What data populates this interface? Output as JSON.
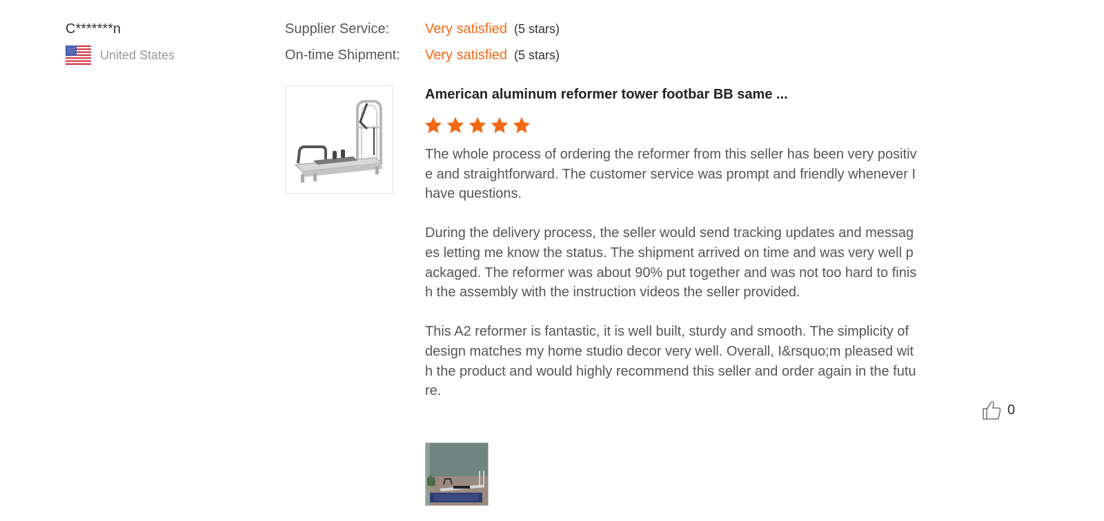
{
  "reviewer": {
    "name": "C*******n",
    "country": "United States",
    "flag_icon": "us-flag-icon"
  },
  "ratings": [
    {
      "label": "Supplier Service:",
      "value": "Very satisfied",
      "stars_text": "(5 stars)"
    },
    {
      "label": "On-time Shipment:",
      "value": "Very satisfied",
      "stars_text": "(5 stars)"
    }
  ],
  "product": {
    "title": "American aluminum reformer tower footbar BB same ...",
    "thumbnail_icon": "reformer-product-image"
  },
  "review": {
    "stars": 5,
    "star_color": "#f06a16",
    "paragraphs": [
      "The whole process of ordering the reformer from this seller has been very positive and straightforward. The customer service was prompt and friendly whenever I have questions.",
      "During the delivery process,  the seller would send tracking updates and messages letting me know the status. The shipment arrived on time and was very well packaged. The reformer was about 90% put together and was not too hard to finish the assembly with the instruction videos the seller provided.",
      "This A2 reformer is fantastic, it is well built, sturdy and smooth. The simplicity of design matches my home studio decor very well. Overall, I&rsquo;m pleased with the product and would highly recommend this seller and order again in the future."
    ]
  },
  "helpful": {
    "icon": "thumbs-up-icon",
    "count": "0"
  },
  "photos": [
    {
      "icon": "review-photo-studio"
    }
  ],
  "colors": {
    "accent": "#f06a16",
    "muted_text": "#999999",
    "body_text": "#555555"
  }
}
